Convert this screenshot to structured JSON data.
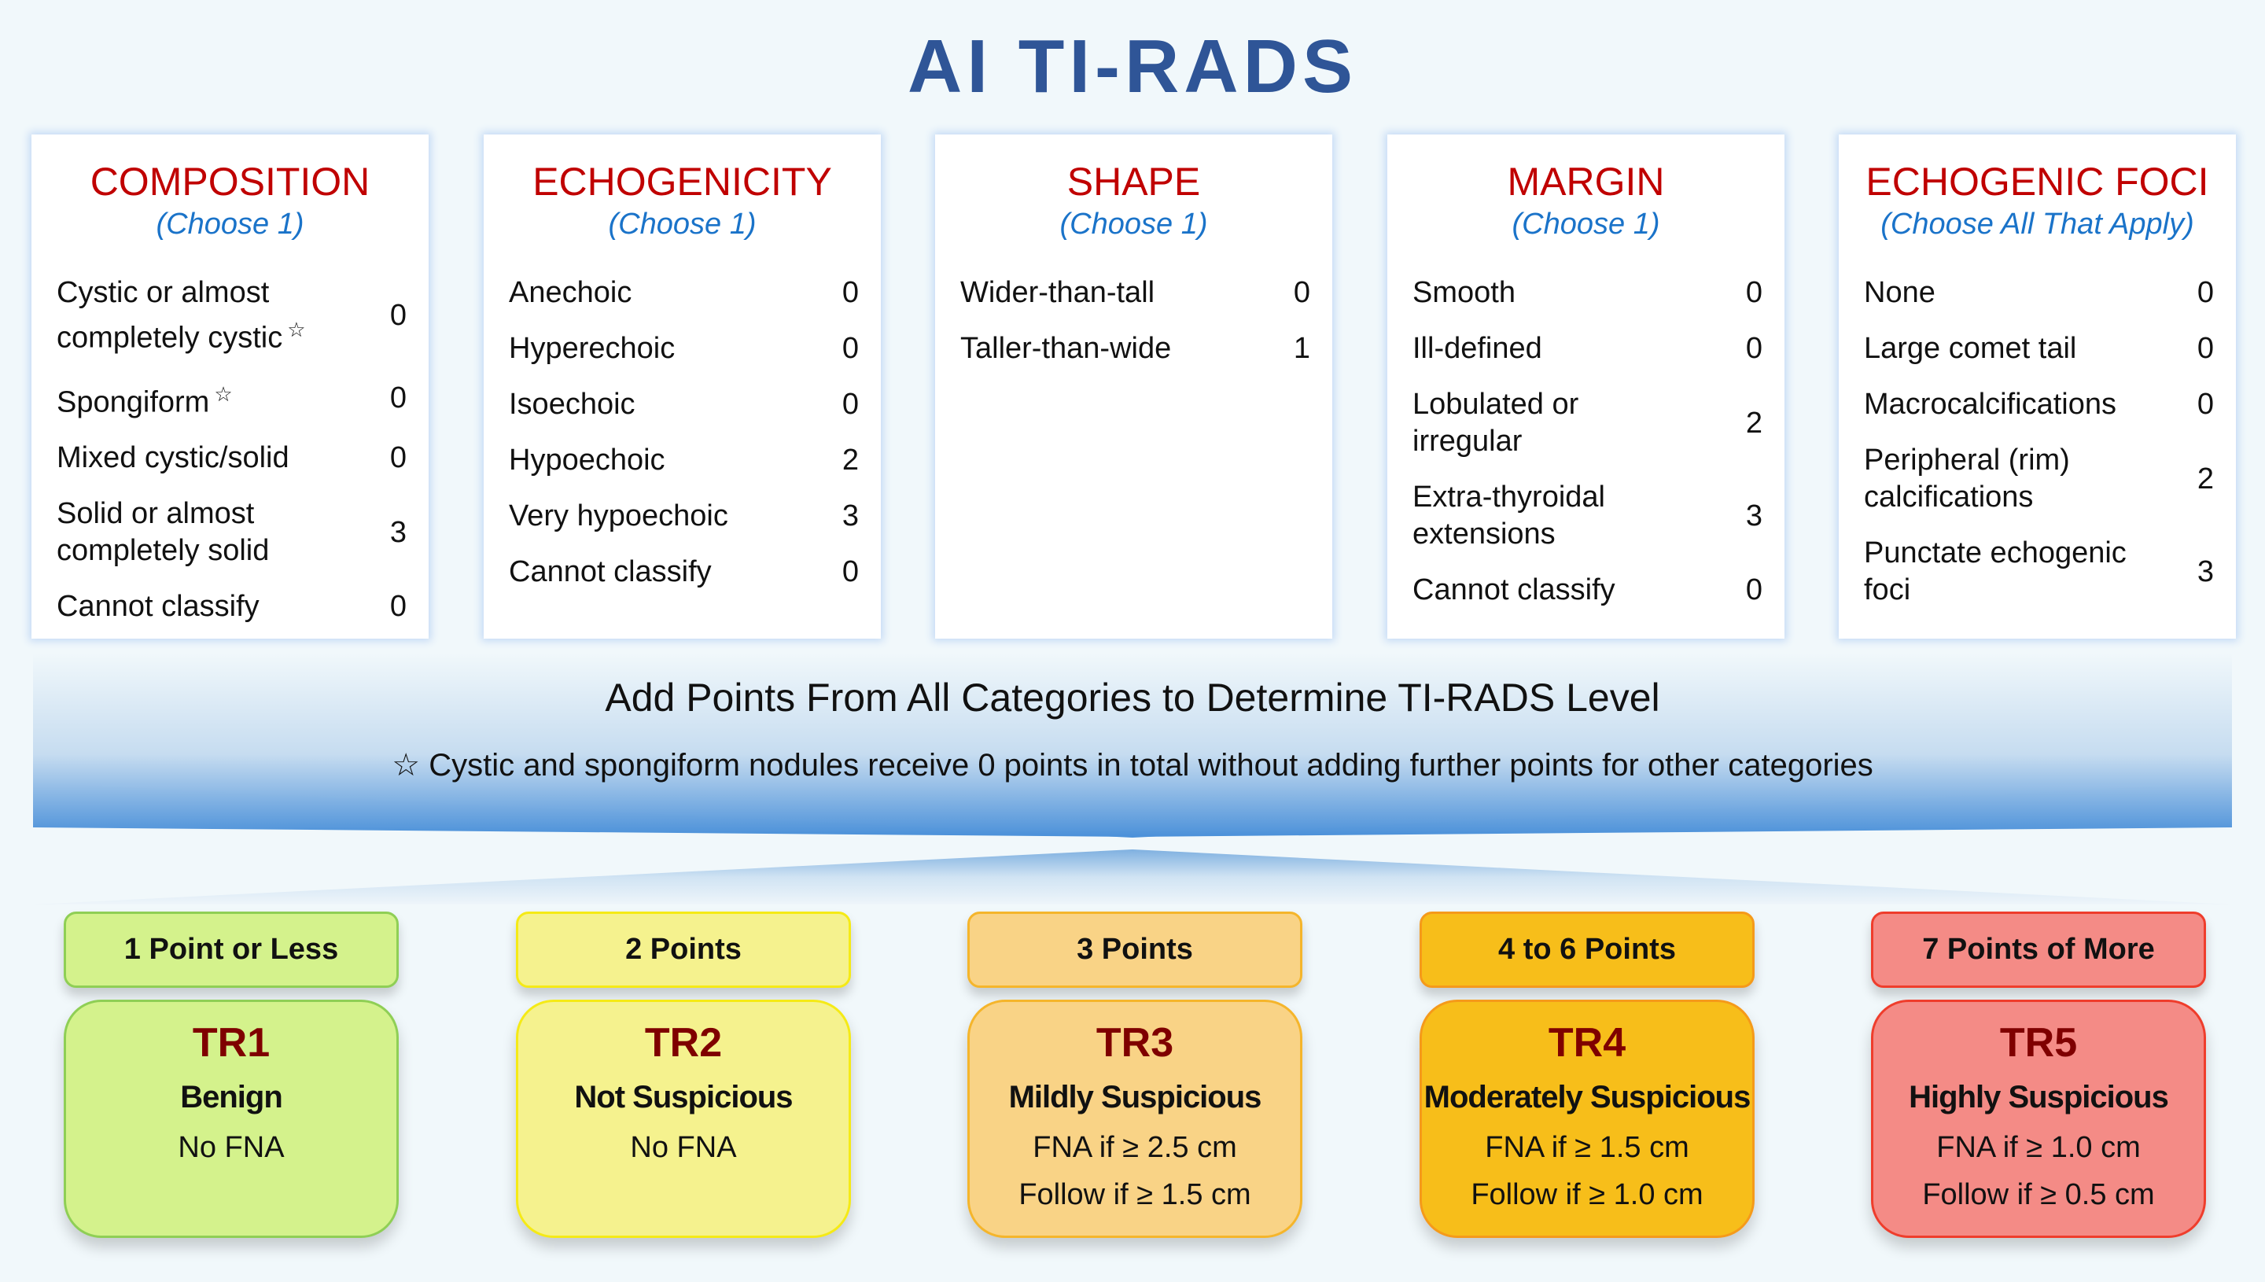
{
  "title": "AI TI-RADS",
  "categories": [
    {
      "title": "COMPOSITION",
      "subtitle": "(Choose 1)",
      "items": [
        {
          "label": "Cystic or almost completely cystic",
          "star": "☆",
          "points": "0"
        },
        {
          "label": "Spongiform",
          "star": "☆",
          "points": "0"
        },
        {
          "label": "Mixed cystic/solid",
          "star": "",
          "points": "0"
        },
        {
          "label": "Solid or almost completely solid",
          "star": "",
          "points": "3"
        },
        {
          "label": "Cannot classify",
          "star": "",
          "points": "0"
        }
      ]
    },
    {
      "title": "ECHOGENICITY",
      "subtitle": "(Choose 1)",
      "items": [
        {
          "label": "Anechoic",
          "star": "",
          "points": "0"
        },
        {
          "label": "Hyperechoic",
          "star": "",
          "points": "0"
        },
        {
          "label": "Isoechoic",
          "star": "",
          "points": "0"
        },
        {
          "label": "Hypoechoic",
          "star": "",
          "points": "2"
        },
        {
          "label": "Very hypoechoic",
          "star": "",
          "points": "3"
        },
        {
          "label": "Cannot classify",
          "star": "",
          "points": "0"
        }
      ]
    },
    {
      "title": "SHAPE",
      "subtitle": "(Choose 1)",
      "items": [
        {
          "label": "Wider-than-tall",
          "star": "",
          "points": "0"
        },
        {
          "label": "Taller-than-wide",
          "star": "",
          "points": "1"
        }
      ]
    },
    {
      "title": "MARGIN",
      "subtitle": "(Choose 1)",
      "items": [
        {
          "label": "Smooth",
          "star": "",
          "points": "0"
        },
        {
          "label": "Ill-defined",
          "star": "",
          "points": "0"
        },
        {
          "label": "Lobulated or irregular",
          "star": "",
          "points": "2"
        },
        {
          "label": "Extra-thyroidal extensions",
          "star": "",
          "points": "3"
        },
        {
          "label": "Cannot classify",
          "star": "",
          "points": "0"
        }
      ]
    },
    {
      "title": "ECHOGENIC FOCI",
      "subtitle": "(Choose All That Apply)",
      "items": [
        {
          "label": "None",
          "star": "",
          "points": "0"
        },
        {
          "label": "Large comet tail",
          "star": "",
          "points": "0"
        },
        {
          "label": "Macrocalcifications",
          "star": "",
          "points": "0"
        },
        {
          "label": "Peripheral (rim) calcifications",
          "star": "",
          "points": "2"
        },
        {
          "label": "Punctate echogenic foci",
          "star": "",
          "points": "3"
        }
      ]
    }
  ],
  "banner": {
    "heading": "Add Points From All Categories to Determine TI-RADS Level",
    "note": "☆ Cystic and spongiform nodules receive 0 points in total without adding further points for other categories"
  },
  "levels": [
    {
      "points_label": "1 Point or Less",
      "code": "TR1",
      "risk": "Benign",
      "rec1": "No FNA",
      "rec2": "",
      "fill": "#d4f28c",
      "border": "#8fcf55"
    },
    {
      "points_label": "2 Points",
      "code": "TR2",
      "risk": "Not Suspicious",
      "rec1": "No FNA",
      "rec2": "",
      "fill": "#f5f28e",
      "border": "#f5ea16"
    },
    {
      "points_label": "3 Points",
      "code": "TR3",
      "risk": "Mildly Suspicious",
      "rec1": "FNA if ≥ 2.5 cm",
      "rec2": "Follow if ≥ 1.5 cm",
      "fill": "#f9d386",
      "border": "#f5b52b"
    },
    {
      "points_label": "4 to 6 Points",
      "code": "TR4",
      "risk": "Moderately Suspicious",
      "rec1": "FNA if ≥ 1.5 cm",
      "rec2": "Follow if ≥ 1.0 cm",
      "fill": "#f7be1a",
      "border": "#f59a1a"
    },
    {
      "points_label": "7 Points of More",
      "code": "TR5",
      "risk": "Highly Suspicious",
      "rec1": "FNA if ≥ 1.0 cm",
      "rec2": "Follow if ≥ 0.5 cm",
      "fill": "#f48b86",
      "border": "#ef3d2c"
    }
  ]
}
